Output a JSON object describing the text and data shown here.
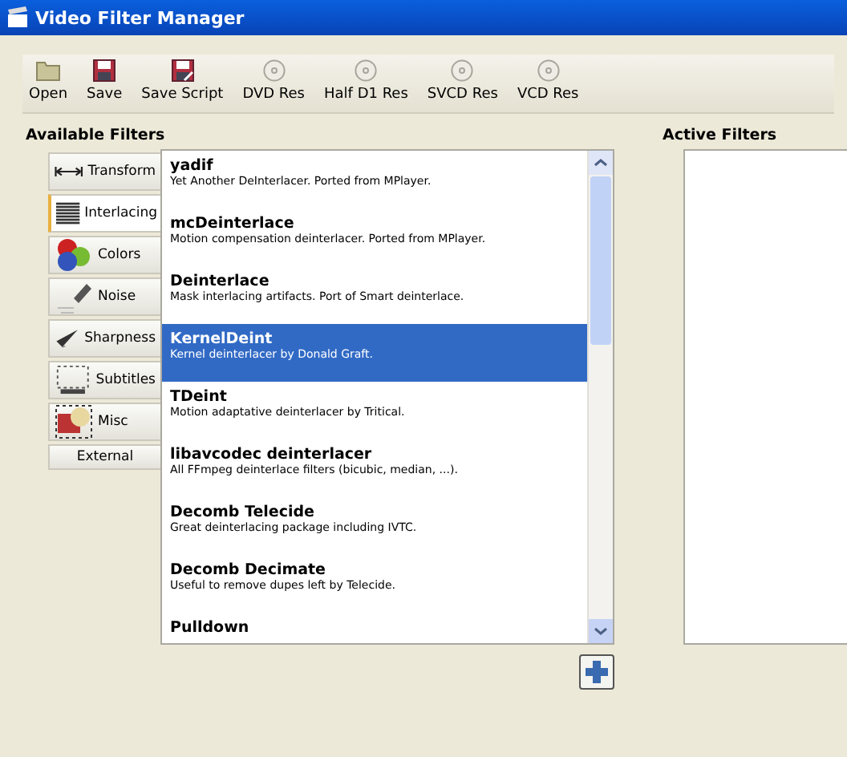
{
  "window": {
    "title": "Video Filter Manager"
  },
  "toolbar": [
    {
      "label": "Open",
      "kind": "open"
    },
    {
      "label": "Save",
      "kind": "save"
    },
    {
      "label": "Save Script",
      "kind": "script"
    },
    {
      "label": "DVD Res",
      "kind": "disc"
    },
    {
      "label": "Half D1 Res",
      "kind": "disc"
    },
    {
      "label": "SVCD Res",
      "kind": "disc"
    },
    {
      "label": "VCD Res",
      "kind": "disc"
    }
  ],
  "available": {
    "title": "Available Filters",
    "categories": [
      {
        "label": "Transform",
        "kind": "transform",
        "selected": false
      },
      {
        "label": "Interlacing",
        "kind": "interlacing",
        "selected": true
      },
      {
        "label": "Colors",
        "kind": "colors",
        "selected": false
      },
      {
        "label": "Noise",
        "kind": "noise",
        "selected": false
      },
      {
        "label": "Sharpness",
        "kind": "sharpness",
        "selected": false
      },
      {
        "label": "Subtitles",
        "kind": "subtitles",
        "selected": false
      },
      {
        "label": "Misc",
        "kind": "misc",
        "selected": false
      },
      {
        "label": "External",
        "kind": "plain",
        "selected": false
      }
    ],
    "filters": [
      {
        "name": "yadif",
        "description": "Yet Another DeInterlacer. Ported from MPlayer.",
        "selected": false
      },
      {
        "name": "mcDeinterlace",
        "description": "Motion compensation deinterlacer. Ported from MPlayer.",
        "selected": false
      },
      {
        "name": "Deinterlace",
        "description": "Mask interlacing artifacts. Port of Smart deinterlace.",
        "selected": false
      },
      {
        "name": "KernelDeint",
        "description": "Kernel deinterlacer by Donald Graft.",
        "selected": true
      },
      {
        "name": "TDeint",
        "description": "Motion adaptative deinterlacer by Tritical.",
        "selected": false
      },
      {
        "name": "libavcodec deinterlacer",
        "description": "All FFmpeg deinterlace filters (bicubic, median, ...).",
        "selected": false
      },
      {
        "name": "Decomb Telecide",
        "description": "Great deinterlacing package including IVTC.",
        "selected": false
      },
      {
        "name": "Decomb Decimate",
        "description": "Useful to remove dupes left by Telecide.",
        "selected": false
      },
      {
        "name": "Pulldown",
        "selected": false
      }
    ]
  },
  "active": {
    "title": "Active Filters"
  }
}
